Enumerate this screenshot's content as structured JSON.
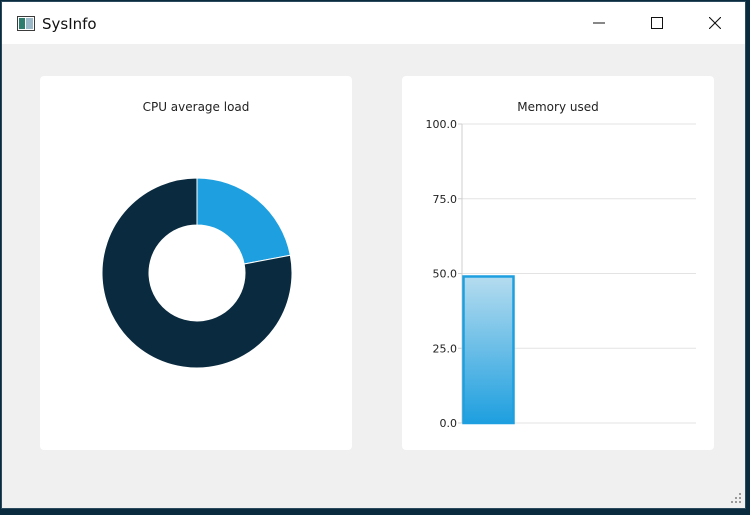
{
  "window": {
    "title": "SysInfo",
    "icon": "app-window-icon",
    "controls": [
      "minimize-icon",
      "maximize-icon",
      "close-icon"
    ]
  },
  "colors": {
    "accent": "#1e9fdf",
    "dark": "#0a2b3f",
    "bar_top": "#b5dcef",
    "bar_bottom": "#1e9fdf",
    "grid": "#e3e3e3"
  },
  "cpu_chart": {
    "title": "CPU average load"
  },
  "memory_chart": {
    "title": "Memory used"
  },
  "chart_data": [
    {
      "type": "pie",
      "title": "CPU average load",
      "donut": true,
      "slices": [
        {
          "value": 22,
          "color": "#1e9fdf"
        },
        {
          "value": 78,
          "color": "#0a2b3f"
        }
      ]
    },
    {
      "type": "bar",
      "title": "Memory used",
      "values": [
        49
      ],
      "ylim": [
        0,
        100
      ],
      "yticks": [
        "0.0",
        "25.0",
        "50.0",
        "75.0",
        "100.0"
      ],
      "grid": true
    }
  ]
}
